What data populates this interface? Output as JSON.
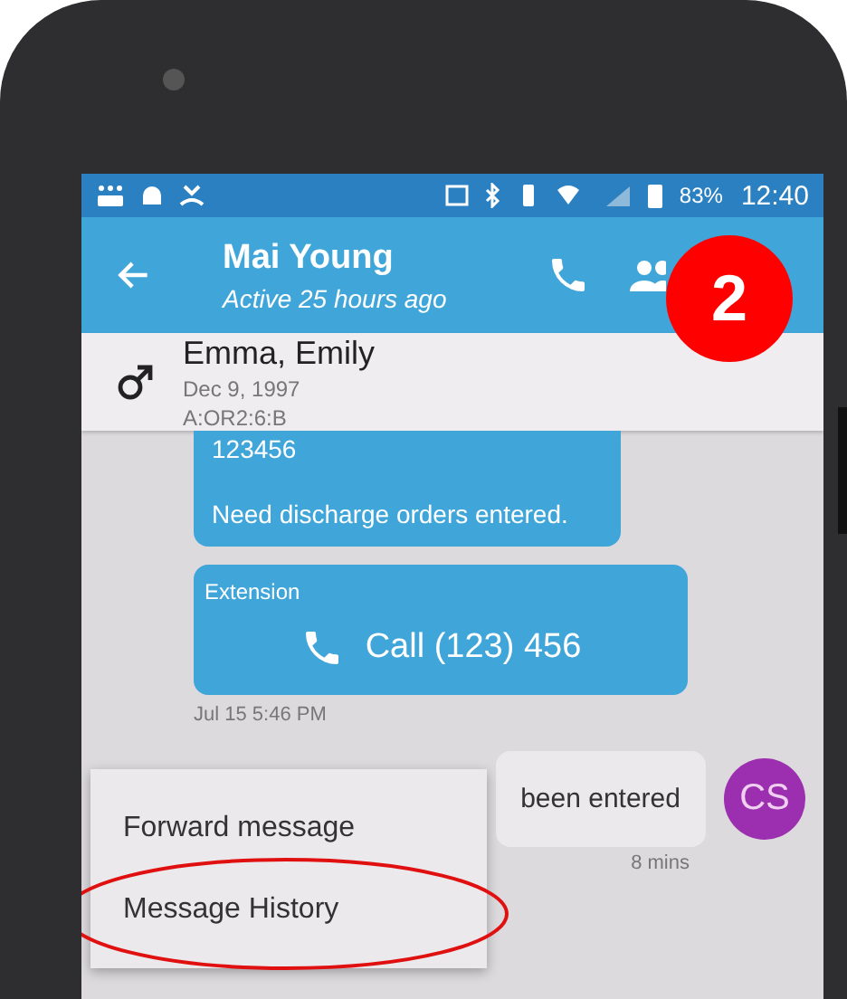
{
  "status_bar": {
    "battery": "83%",
    "time": "12:40"
  },
  "app_bar": {
    "title": "Mai Young",
    "subtitle": "Active 25 hours ago"
  },
  "patient": {
    "name": "Emma, Emily",
    "dob": "Dec 9, 1997",
    "location": "A:OR2:6:B"
  },
  "messages": [
    {
      "kind": "text",
      "lines": [
        "123456",
        "Need discharge orders entered."
      ]
    },
    {
      "kind": "call",
      "label": "Extension",
      "action": "Call (123) 456",
      "time": "Jul 15 5:46 PM"
    },
    {
      "kind": "incoming",
      "text": "been entered",
      "avatar": "CS",
      "color": "#9c2fb0",
      "time": "8 mins"
    }
  ],
  "context_menu": {
    "items": [
      {
        "label": "Forward message",
        "circled": false
      },
      {
        "label": "Message History",
        "circled": true
      }
    ]
  },
  "annotation": {
    "badge": "2"
  }
}
